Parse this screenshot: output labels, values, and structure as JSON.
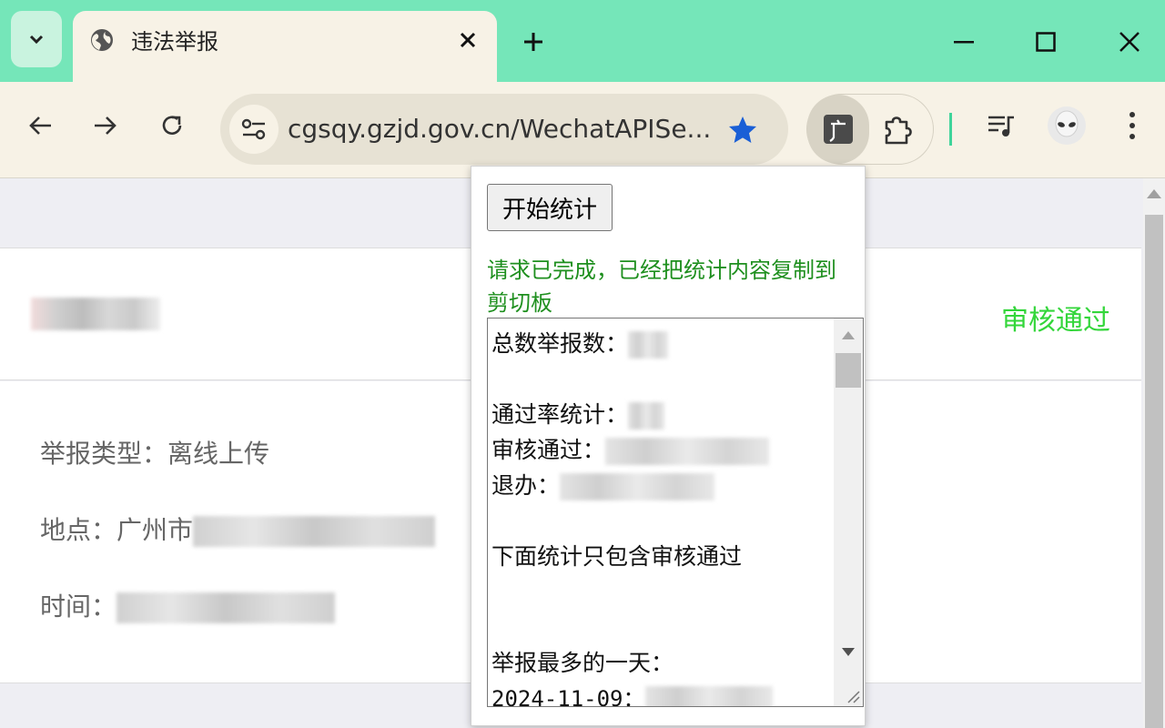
{
  "browser": {
    "tab_title": "违法举报",
    "url": "cgsqy.gzjd.gov.cn/WechatAPISe...",
    "colors": {
      "frame": "#75e6b9",
      "toolbar": "#f7f2e6",
      "star": "#1a5fd6"
    }
  },
  "page": {
    "status": "审核通过",
    "report_type_label": "举报类型：",
    "report_type_value": "离线上传",
    "location_label": "地点：",
    "location_value": "广州市",
    "time_label": "时间："
  },
  "popup": {
    "start_button": "开始统计",
    "message": "请求已完成，已经把统计内容复制到剪切板",
    "stats": {
      "total_label": "总数举报数：",
      "pass_rate_label": "通过率统计：",
      "approved_label": "审核通过：",
      "returned_label": "退办：",
      "note": "下面统计只包含审核通过",
      "max_day_label": "举报最多的一天：",
      "max_day_date": "2024-11-09："
    }
  }
}
